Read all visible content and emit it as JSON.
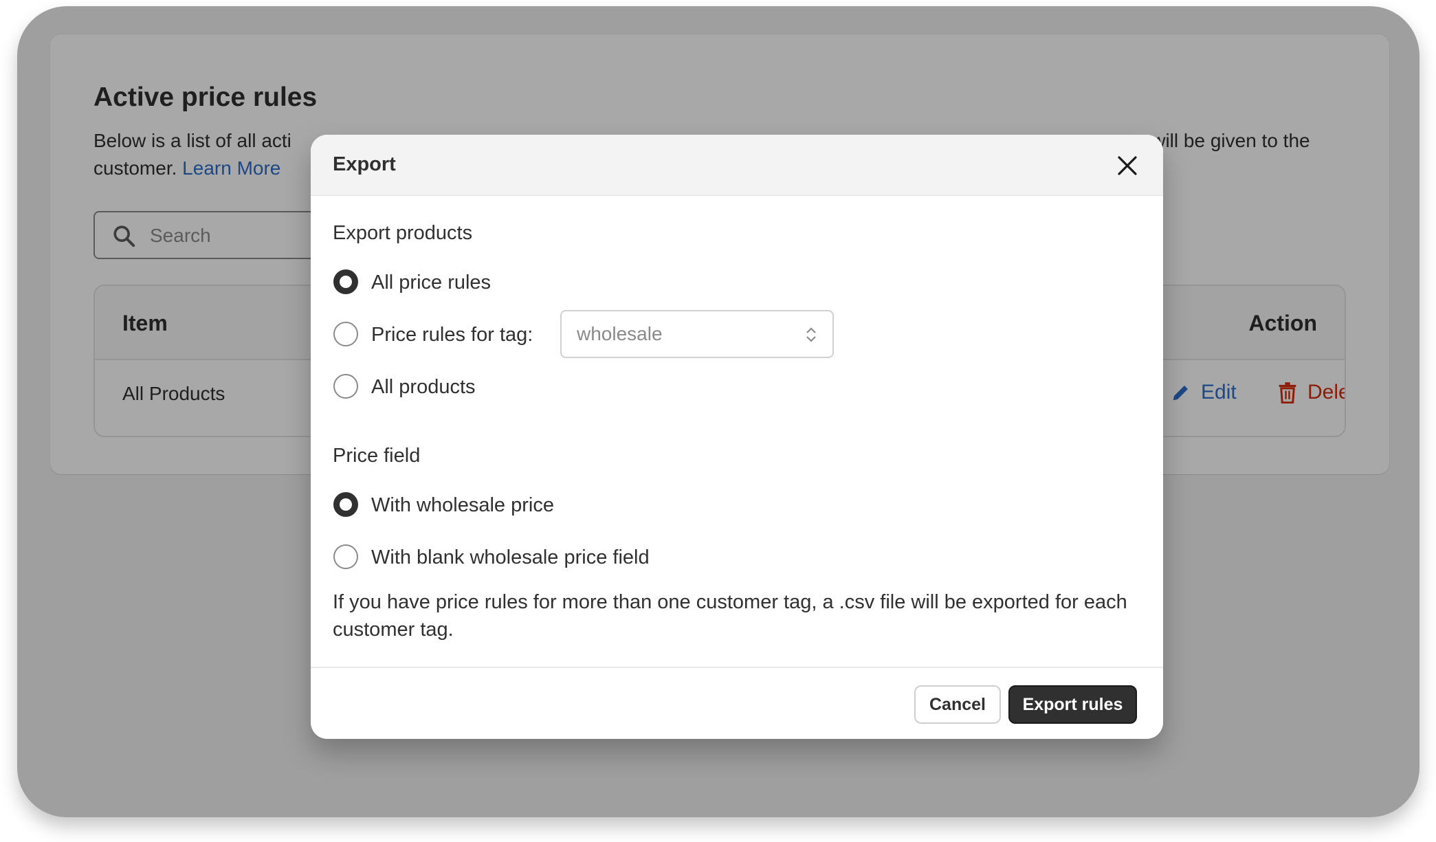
{
  "page": {
    "title": "Active price rules",
    "description_line1": "Below is a list of all acti",
    "description_line1_tail": "e will be given to the",
    "description_line2": "customer.",
    "learn_more": "Learn More",
    "search_placeholder": "Search",
    "table": {
      "col_item": "Item",
      "col_action": "Action",
      "rows": [
        {
          "item": "All Products",
          "edit": "Edit",
          "delete": "Delete"
        }
      ]
    }
  },
  "modal": {
    "title": "Export",
    "export_products_label": "Export products",
    "product_options": [
      {
        "label": "All price rules",
        "selected": true
      },
      {
        "label": "Price rules for tag:",
        "selected": false
      },
      {
        "label": "All products",
        "selected": false
      }
    ],
    "tag_select_value": "wholesale",
    "price_field_label": "Price field",
    "price_options": [
      {
        "label": "With wholesale price",
        "selected": true
      },
      {
        "label": "With blank wholesale price field",
        "selected": false
      }
    ],
    "note": "If you have price rules for more than one customer tag, a .csv file will be exported for each customer tag.",
    "cancel_label": "Cancel",
    "export_label": "Export rules"
  },
  "colors": {
    "accent_dark": "#303030",
    "link": "#2c6ecb",
    "danger": "#d72c0d"
  },
  "icons": [
    "search-icon",
    "pencil-icon",
    "trash-icon",
    "close-icon",
    "select-chevron-icon"
  ]
}
